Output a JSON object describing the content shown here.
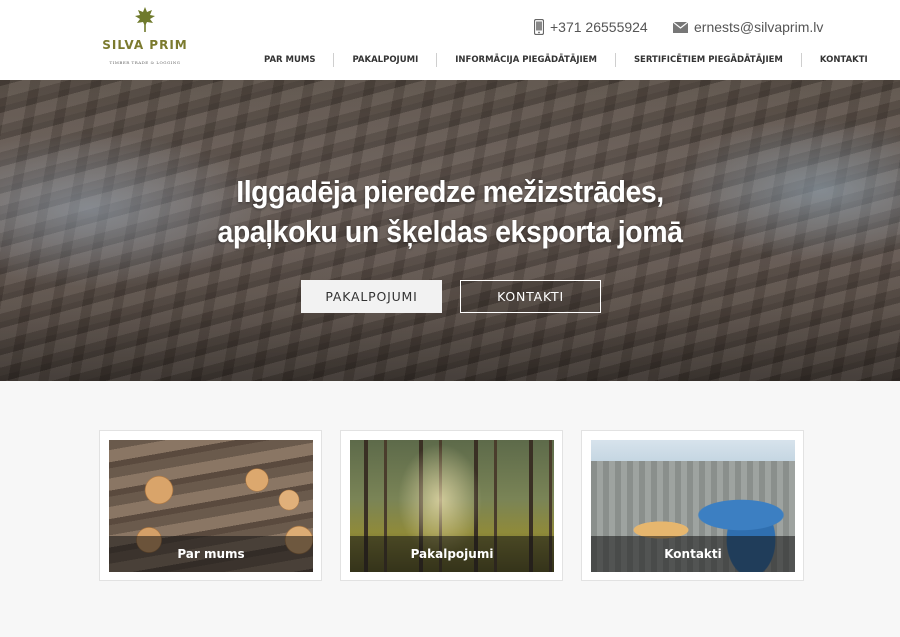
{
  "brand": {
    "name": "SILVA PRIM",
    "tagline": "TIMBER TRADE & LOGGING",
    "accent_color": "#7b7a2e"
  },
  "contacts": {
    "phone": "+371 26555924",
    "phone_icon": "mobile-phone-icon",
    "email": "ernests@silvaprim.lv",
    "email_icon": "envelope-icon"
  },
  "nav": {
    "items": [
      {
        "label": "PAR MUMS"
      },
      {
        "label": "PAKALPOJUMI"
      },
      {
        "label": "INFORMĀCIJA PIEGĀDĀTĀJIEM"
      },
      {
        "label": "SERTIFICĒTIEM PIEGĀDĀTĀJIEM"
      },
      {
        "label": "KONTAKTI"
      }
    ]
  },
  "hero": {
    "title_line1": "Ilggadēja pieredze mežizstrādes,",
    "title_line2": "apaļkoku un šķeldas eksporta jomā",
    "primary_button": "PAKALPOJUMI",
    "secondary_button": "KONTAKTI"
  },
  "cards": [
    {
      "label": "Par mums"
    },
    {
      "label": "Pakalpojumi"
    },
    {
      "label": "Kontakti"
    }
  ]
}
